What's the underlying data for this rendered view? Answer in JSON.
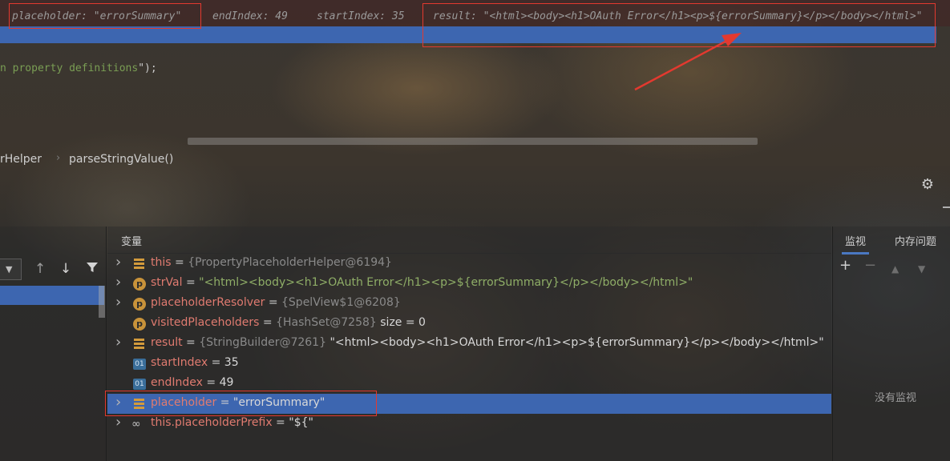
{
  "debug_hints": {
    "placeholder": "placeholder: \"errorSummary\"",
    "end_index": "endIndex: 49",
    "start_index": "startIndex: 35",
    "result": "result: \"<html><body><h1>OAuth Error</h1><p>${errorSummary}</p></body></html>\""
  },
  "code": {
    "prefix": "n property definitions",
    "suffix": "\");"
  },
  "breadcrumb": {
    "class_fragment": "rHelper",
    "method": "parseStringValue()"
  },
  "debugger": {
    "variables_title": "变量",
    "watch_tab": "监视",
    "memory_tab": "内存问题",
    "no_watches": "没有监视",
    "variables": [
      {
        "name": "this",
        "eq": " = ",
        "type": "{PropertyPlaceholderHelper@6194}",
        "value": "",
        "icon": "field-icon",
        "expandable": true
      },
      {
        "name": "strVal",
        "eq": " = ",
        "type": "",
        "value": "\"<html><body><h1>OAuth Error</h1><p>${errorSummary}</p></body></html>\"",
        "icon": "parameter-icon",
        "expandable": true
      },
      {
        "name": "placeholderResolver",
        "eq": " = ",
        "type": "{SpelView$1@6208}",
        "value": "",
        "icon": "parameter-icon",
        "expandable": true
      },
      {
        "name": "visitedPlaceholders",
        "eq": " = ",
        "type": "{HashSet@7258}",
        "value": "  size = 0",
        "icon": "parameter-icon",
        "expandable": false
      },
      {
        "name": "result",
        "eq": " = ",
        "type": "{StringBuilder@7261}",
        "value": " \"<html><body><h1>OAuth Error</h1><p>${errorSummary}</p></body></html>\"",
        "icon": "field-icon",
        "expandable": true
      },
      {
        "name": "startIndex",
        "eq": " = ",
        "type": "",
        "value": "35",
        "icon": "primitive-icon",
        "expandable": false
      },
      {
        "name": "endIndex",
        "eq": " = ",
        "type": "",
        "value": "49",
        "icon": "primitive-icon",
        "expandable": false
      },
      {
        "name": "placeholder",
        "eq": " = ",
        "type": "",
        "value": "\"errorSummary\"",
        "icon": "field-icon",
        "expandable": true
      },
      {
        "name": "this.placeholderPrefix",
        "eq": " = ",
        "type": "",
        "value": "\"${\"",
        "icon": "watch-icon",
        "expandable": true
      }
    ]
  },
  "icons": {
    "param_letter": "p",
    "prim_label": "01"
  }
}
